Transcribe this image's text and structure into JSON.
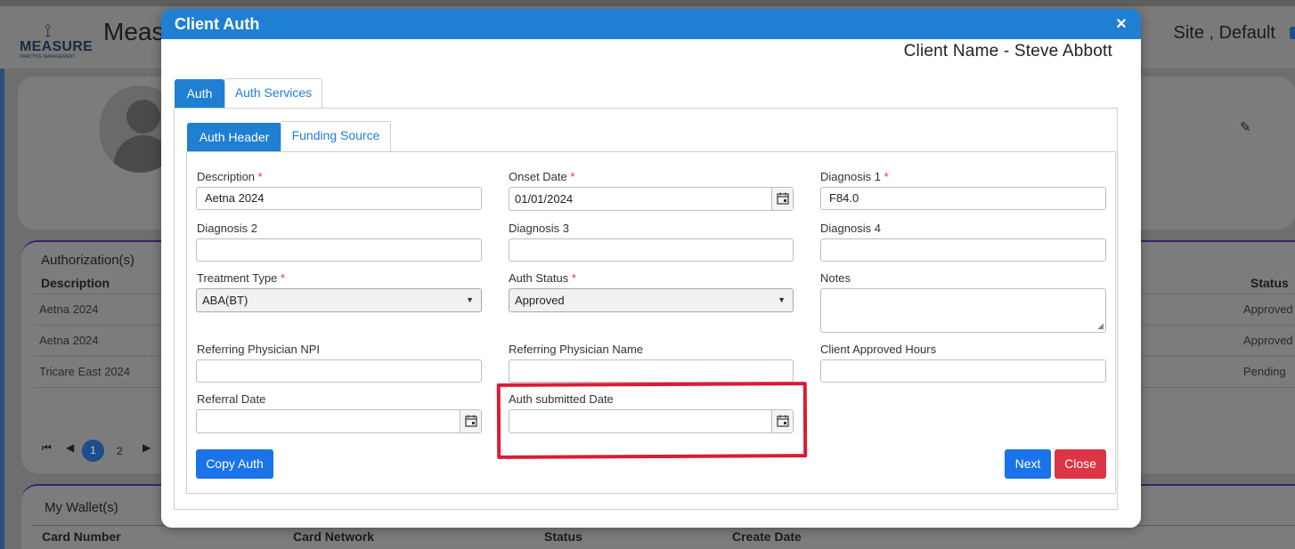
{
  "background": {
    "app_title": "Meas",
    "logo_text": "MEASURE",
    "logo_subtext": "PRACTICE MANAGEMENT",
    "site_label": "Site , Default",
    "authorizations": {
      "title": "Authorization(s)",
      "columns": [
        "Description",
        "Status"
      ],
      "rows": [
        {
          "description": "Aetna 2024",
          "status": "Approved"
        },
        {
          "description": "Aetna 2024",
          "status": "Approved"
        },
        {
          "description": "Tricare East 2024",
          "status": "Pending"
        }
      ],
      "pager": {
        "first": "⏮",
        "prev": "◀",
        "current": "1",
        "next_page": "2",
        "next": "▶"
      }
    },
    "wallet": {
      "title": "My Wallet(s)",
      "columns": [
        "Card Number",
        "Card Network",
        "Status",
        "Create Date"
      ]
    }
  },
  "modal": {
    "title": "Client Auth",
    "close_symbol": "×",
    "client_name": "Client Name - Steve Abbott",
    "tabs": [
      "Auth",
      "Auth Services"
    ],
    "subtabs": [
      "Auth Header",
      "Funding Source"
    ],
    "fields": {
      "description": {
        "label": "Description",
        "required": "*",
        "value": "Aetna 2024"
      },
      "onset_date": {
        "label": "Onset Date",
        "required": "*",
        "value": "01/01/2024"
      },
      "diagnosis1": {
        "label": "Diagnosis 1",
        "required": "*",
        "value": "F84.0"
      },
      "diagnosis2": {
        "label": "Diagnosis 2",
        "value": ""
      },
      "diagnosis3": {
        "label": "Diagnosis 3",
        "value": ""
      },
      "diagnosis4": {
        "label": "Diagnosis 4",
        "value": ""
      },
      "treatment_type": {
        "label": "Treatment Type",
        "required": "*",
        "value": "ABA(BT)"
      },
      "auth_status": {
        "label": "Auth Status",
        "required": "*",
        "value": "Approved"
      },
      "notes": {
        "label": "Notes",
        "value": ""
      },
      "ref_npi": {
        "label": "Referring Physician NPI",
        "value": ""
      },
      "ref_name": {
        "label": "Referring Physician Name",
        "value": ""
      },
      "approved_hours": {
        "label": "Client Approved Hours",
        "value": ""
      },
      "referral_date": {
        "label": "Referral Date",
        "value": ""
      },
      "auth_submitted_date": {
        "label": "Auth submitted Date",
        "value": ""
      }
    },
    "buttons": {
      "copy_auth": "Copy Auth",
      "next": "Next",
      "close": "Close"
    }
  },
  "colors": {
    "primary": "#1f7fd2",
    "button_blue": "#1a73e8",
    "button_red": "#dc3545",
    "highlight": "#dc1b34",
    "required": "#e03a3a"
  }
}
